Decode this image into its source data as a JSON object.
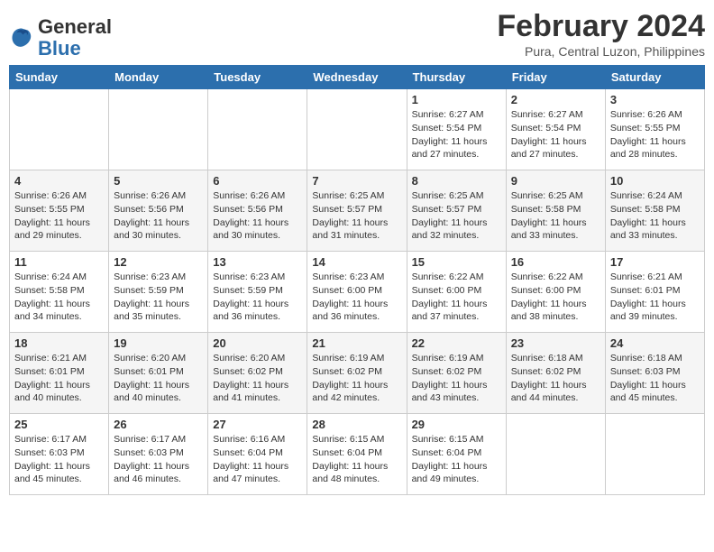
{
  "logo": {
    "text_general": "General",
    "text_blue": "Blue"
  },
  "header": {
    "month": "February 2024",
    "location": "Pura, Central Luzon, Philippines"
  },
  "weekdays": [
    "Sunday",
    "Monday",
    "Tuesday",
    "Wednesday",
    "Thursday",
    "Friday",
    "Saturday"
  ],
  "weeks": [
    [
      {
        "day": "",
        "info": ""
      },
      {
        "day": "",
        "info": ""
      },
      {
        "day": "",
        "info": ""
      },
      {
        "day": "",
        "info": ""
      },
      {
        "day": "1",
        "info": "Sunrise: 6:27 AM\nSunset: 5:54 PM\nDaylight: 11 hours\nand 27 minutes."
      },
      {
        "day": "2",
        "info": "Sunrise: 6:27 AM\nSunset: 5:54 PM\nDaylight: 11 hours\nand 27 minutes."
      },
      {
        "day": "3",
        "info": "Sunrise: 6:26 AM\nSunset: 5:55 PM\nDaylight: 11 hours\nand 28 minutes."
      }
    ],
    [
      {
        "day": "4",
        "info": "Sunrise: 6:26 AM\nSunset: 5:55 PM\nDaylight: 11 hours\nand 29 minutes."
      },
      {
        "day": "5",
        "info": "Sunrise: 6:26 AM\nSunset: 5:56 PM\nDaylight: 11 hours\nand 30 minutes."
      },
      {
        "day": "6",
        "info": "Sunrise: 6:26 AM\nSunset: 5:56 PM\nDaylight: 11 hours\nand 30 minutes."
      },
      {
        "day": "7",
        "info": "Sunrise: 6:25 AM\nSunset: 5:57 PM\nDaylight: 11 hours\nand 31 minutes."
      },
      {
        "day": "8",
        "info": "Sunrise: 6:25 AM\nSunset: 5:57 PM\nDaylight: 11 hours\nand 32 minutes."
      },
      {
        "day": "9",
        "info": "Sunrise: 6:25 AM\nSunset: 5:58 PM\nDaylight: 11 hours\nand 33 minutes."
      },
      {
        "day": "10",
        "info": "Sunrise: 6:24 AM\nSunset: 5:58 PM\nDaylight: 11 hours\nand 33 minutes."
      }
    ],
    [
      {
        "day": "11",
        "info": "Sunrise: 6:24 AM\nSunset: 5:58 PM\nDaylight: 11 hours\nand 34 minutes."
      },
      {
        "day": "12",
        "info": "Sunrise: 6:23 AM\nSunset: 5:59 PM\nDaylight: 11 hours\nand 35 minutes."
      },
      {
        "day": "13",
        "info": "Sunrise: 6:23 AM\nSunset: 5:59 PM\nDaylight: 11 hours\nand 36 minutes."
      },
      {
        "day": "14",
        "info": "Sunrise: 6:23 AM\nSunset: 6:00 PM\nDaylight: 11 hours\nand 36 minutes."
      },
      {
        "day": "15",
        "info": "Sunrise: 6:22 AM\nSunset: 6:00 PM\nDaylight: 11 hours\nand 37 minutes."
      },
      {
        "day": "16",
        "info": "Sunrise: 6:22 AM\nSunset: 6:00 PM\nDaylight: 11 hours\nand 38 minutes."
      },
      {
        "day": "17",
        "info": "Sunrise: 6:21 AM\nSunset: 6:01 PM\nDaylight: 11 hours\nand 39 minutes."
      }
    ],
    [
      {
        "day": "18",
        "info": "Sunrise: 6:21 AM\nSunset: 6:01 PM\nDaylight: 11 hours\nand 40 minutes."
      },
      {
        "day": "19",
        "info": "Sunrise: 6:20 AM\nSunset: 6:01 PM\nDaylight: 11 hours\nand 40 minutes."
      },
      {
        "day": "20",
        "info": "Sunrise: 6:20 AM\nSunset: 6:02 PM\nDaylight: 11 hours\nand 41 minutes."
      },
      {
        "day": "21",
        "info": "Sunrise: 6:19 AM\nSunset: 6:02 PM\nDaylight: 11 hours\nand 42 minutes."
      },
      {
        "day": "22",
        "info": "Sunrise: 6:19 AM\nSunset: 6:02 PM\nDaylight: 11 hours\nand 43 minutes."
      },
      {
        "day": "23",
        "info": "Sunrise: 6:18 AM\nSunset: 6:02 PM\nDaylight: 11 hours\nand 44 minutes."
      },
      {
        "day": "24",
        "info": "Sunrise: 6:18 AM\nSunset: 6:03 PM\nDaylight: 11 hours\nand 45 minutes."
      }
    ],
    [
      {
        "day": "25",
        "info": "Sunrise: 6:17 AM\nSunset: 6:03 PM\nDaylight: 11 hours\nand 45 minutes."
      },
      {
        "day": "26",
        "info": "Sunrise: 6:17 AM\nSunset: 6:03 PM\nDaylight: 11 hours\nand 46 minutes."
      },
      {
        "day": "27",
        "info": "Sunrise: 6:16 AM\nSunset: 6:04 PM\nDaylight: 11 hours\nand 47 minutes."
      },
      {
        "day": "28",
        "info": "Sunrise: 6:15 AM\nSunset: 6:04 PM\nDaylight: 11 hours\nand 48 minutes."
      },
      {
        "day": "29",
        "info": "Sunrise: 6:15 AM\nSunset: 6:04 PM\nDaylight: 11 hours\nand 49 minutes."
      },
      {
        "day": "",
        "info": ""
      },
      {
        "day": "",
        "info": ""
      }
    ]
  ]
}
